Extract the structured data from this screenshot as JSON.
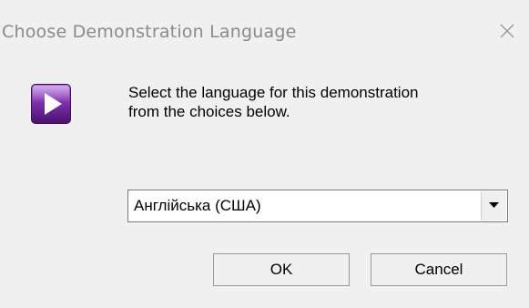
{
  "window": {
    "title": "Choose Demonstration Language",
    "close_icon": "close-icon"
  },
  "dialog": {
    "icon": "play-icon",
    "message_line1": "Select the language for this demonstration",
    "message_line2": "from the choices below.",
    "language_select": {
      "selected": "Англійська (США)",
      "arrow_icon": "dropdown-arrow-icon"
    },
    "buttons": {
      "ok_label": "OK",
      "cancel_label": "Cancel"
    }
  },
  "colors": {
    "dialog_background": "#f0f0f0",
    "title_text": "#8a8a8a",
    "icon_purple": "#7a2fa8"
  }
}
